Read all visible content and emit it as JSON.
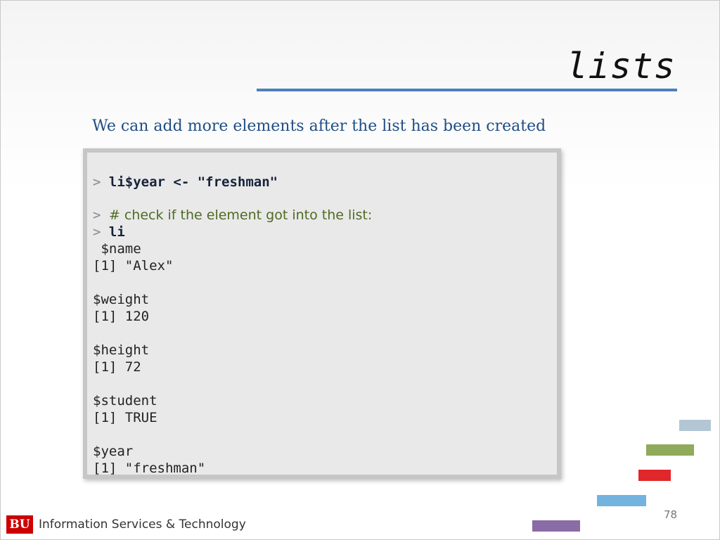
{
  "slide": {
    "title": "lists",
    "subtitle": "We can add more elements after the list has been created",
    "page_number": "78"
  },
  "code": {
    "prompt": ">",
    "command_1": "li$year <- \"freshman\"",
    "comment": "# check if the element got into the list:",
    "command_2": "li",
    "output": [
      " $name",
      "[1] \"Alex\"",
      "",
      "$weight",
      "[1] 120",
      "",
      "$height",
      "[1] 72",
      "",
      "$student",
      "[1] TRUE",
      "",
      "$year",
      "[1] \"freshman\""
    ]
  },
  "footer": {
    "logo_text": "BU",
    "org_name": "Information Services & Technology"
  },
  "colors": {
    "accent_rule": "#4f7fb9",
    "subtitle": "#1f4e85",
    "comment": "#4f6a22",
    "bu_red": "#cc0000",
    "bar_lightblue": "#b3c6d4",
    "bar_green": "#8faa5a",
    "bar_red": "#e0272a",
    "bar_blue": "#73b3e0",
    "bar_purple": "#8a6ca6"
  }
}
